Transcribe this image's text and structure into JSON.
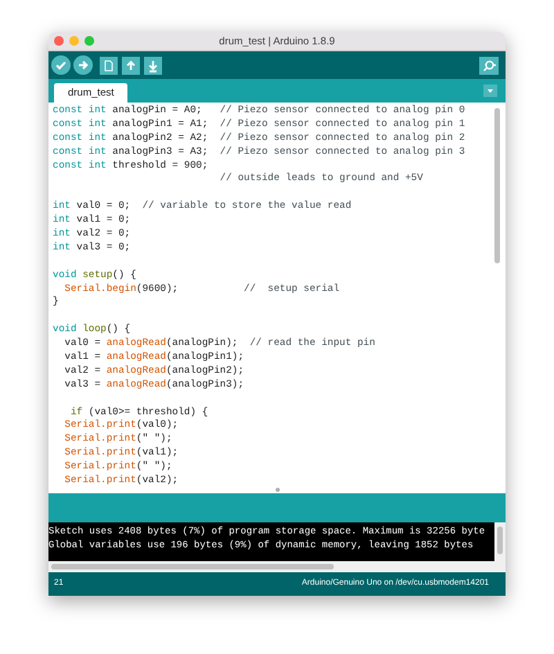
{
  "window": {
    "title": "drum_test | Arduino 1.8.9"
  },
  "tabs": [
    {
      "label": "drum_test",
      "selected": true
    }
  ],
  "editor": {
    "blocks": [
      {
        "lines": [
          [
            {
              "text": "const",
              "kind": "keyword"
            },
            {
              "text": " int",
              "kind": "keyword"
            },
            {
              "text": " analogPin = A0;",
              "kind": "plain"
            },
            {
              "text": "   // Piezo sensor connected to analog pin 0",
              "kind": "comment"
            }
          ],
          [
            {
              "text": "const",
              "kind": "keyword"
            },
            {
              "text": " int",
              "kind": "keyword"
            },
            {
              "text": " analogPin1 = A1;",
              "kind": "plain"
            },
            {
              "text": "  // Piezo sensor connected to analog pin 1",
              "kind": "comment"
            }
          ],
          [
            {
              "text": "const",
              "kind": "keyword"
            },
            {
              "text": " int",
              "kind": "keyword"
            },
            {
              "text": " analogPin2 = A2;",
              "kind": "plain"
            },
            {
              "text": "  // Piezo sensor connected to analog pin 2",
              "kind": "comment"
            }
          ],
          [
            {
              "text": "const",
              "kind": "keyword"
            },
            {
              "text": " int",
              "kind": "keyword"
            },
            {
              "text": " analogPin3 = A3;",
              "kind": "plain"
            },
            {
              "text": "  // Piezo sensor connected to analog pin 3",
              "kind": "comment"
            }
          ],
          [
            {
              "text": "const",
              "kind": "keyword"
            },
            {
              "text": " int",
              "kind": "keyword"
            },
            {
              "text": " threshold = 900;",
              "kind": "plain"
            }
          ],
          [
            {
              "text": "                            // outside leads to ground and +5V",
              "kind": "comment"
            }
          ]
        ]
      },
      {
        "lines": [
          [
            {
              "text": "int",
              "kind": "keyword"
            },
            {
              "text": " val0 = 0;",
              "kind": "plain"
            },
            {
              "text": "  // variable to store the value read",
              "kind": "comment"
            }
          ],
          [
            {
              "text": "int",
              "kind": "keyword"
            },
            {
              "text": " val1 = 0;",
              "kind": "plain"
            }
          ],
          [
            {
              "text": "int",
              "kind": "keyword"
            },
            {
              "text": " val2 = 0;",
              "kind": "plain"
            }
          ],
          [
            {
              "text": "int",
              "kind": "keyword"
            },
            {
              "text": " val3 = 0;",
              "kind": "plain"
            }
          ]
        ]
      },
      {
        "lines": [
          [
            {
              "text": "void",
              "kind": "keyword"
            },
            {
              "text": " setup",
              "kind": "structure"
            },
            {
              "text": "() {",
              "kind": "plain"
            }
          ],
          [
            {
              "text": "  Serial.begin",
              "kind": "function"
            },
            {
              "text": "(9600);",
              "kind": "plain"
            },
            {
              "text": "           //  setup serial",
              "kind": "comment"
            }
          ],
          [
            {
              "text": "}",
              "kind": "plain"
            }
          ]
        ]
      },
      {
        "lines": [
          [
            {
              "text": "void",
              "kind": "keyword"
            },
            {
              "text": " loop",
              "kind": "structure"
            },
            {
              "text": "() {",
              "kind": "plain"
            }
          ],
          [
            {
              "text": "  val0 = ",
              "kind": "plain"
            },
            {
              "text": "analogRead",
              "kind": "function"
            },
            {
              "text": "(analogPin);",
              "kind": "plain"
            },
            {
              "text": "  // read the input pin",
              "kind": "comment"
            }
          ],
          [
            {
              "text": "  val1 = ",
              "kind": "plain"
            },
            {
              "text": "analogRead",
              "kind": "function"
            },
            {
              "text": "(analogPin1);",
              "kind": "plain"
            }
          ],
          [
            {
              "text": "  val2 = ",
              "kind": "plain"
            },
            {
              "text": "analogRead",
              "kind": "function"
            },
            {
              "text": "(analogPin2);",
              "kind": "plain"
            }
          ],
          [
            {
              "text": "  val3 = ",
              "kind": "plain"
            },
            {
              "text": "analogRead",
              "kind": "function"
            },
            {
              "text": "(analogPin3);",
              "kind": "plain"
            }
          ]
        ]
      },
      {
        "lines": [
          [
            {
              "text": "   if",
              "kind": "structure"
            },
            {
              "text": " (val0>= threshold) {",
              "kind": "plain"
            }
          ],
          [
            {
              "text": "  Serial.print",
              "kind": "function"
            },
            {
              "text": "(val0);",
              "kind": "plain"
            }
          ],
          [
            {
              "text": "  Serial.print",
              "kind": "function"
            },
            {
              "text": "(\" \");",
              "kind": "plain"
            }
          ],
          [
            {
              "text": "  Serial.print",
              "kind": "function"
            },
            {
              "text": "(val1);",
              "kind": "plain"
            }
          ],
          [
            {
              "text": "  Serial.print",
              "kind": "function"
            },
            {
              "text": "(\" \");",
              "kind": "plain"
            }
          ],
          [
            {
              "text": "  Serial.print",
              "kind": "function"
            },
            {
              "text": "(val2);",
              "kind": "plain"
            }
          ]
        ]
      }
    ]
  },
  "console": {
    "lines": [
      "Sketch uses 2408 bytes (7%) of program storage space. Maximum is 32256 byte",
      "Global variables use 196 bytes (9%) of dynamic memory, leaving 1852 bytes"
    ]
  },
  "status_bar": {
    "line": "21",
    "board": "Arduino/Genuino Uno on /dev/cu.usbmodem14201"
  }
}
